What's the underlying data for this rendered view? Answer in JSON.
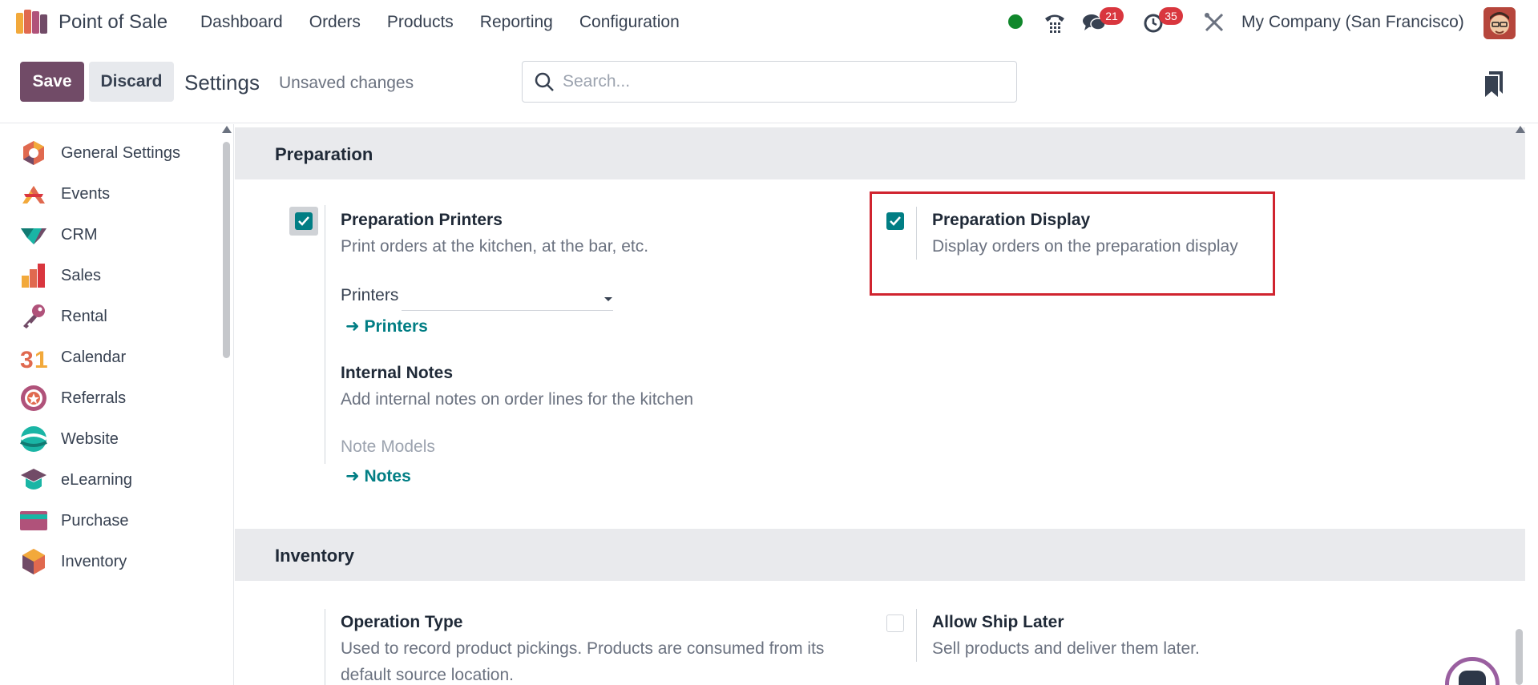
{
  "navbar": {
    "app_name": "Point of Sale",
    "menu": [
      "Dashboard",
      "Orders",
      "Products",
      "Reporting",
      "Configuration"
    ],
    "messages_count": "21",
    "activities_count": "35",
    "company": "My Company (San Francisco)",
    "status_color": "#10872b"
  },
  "control": {
    "save_label": "Save",
    "discard_label": "Discard",
    "title": "Settings",
    "status": "Unsaved changes",
    "search_placeholder": "Search..."
  },
  "sidebar": {
    "items": [
      {
        "label": "General Settings",
        "icon": "odoo-icon"
      },
      {
        "label": "Events",
        "icon": "events-icon"
      },
      {
        "label": "CRM",
        "icon": "crm-icon"
      },
      {
        "label": "Sales",
        "icon": "sales-icon"
      },
      {
        "label": "Rental",
        "icon": "rental-icon"
      },
      {
        "label": "Calendar",
        "icon": "calendar-icon"
      },
      {
        "label": "Referrals",
        "icon": "referrals-icon"
      },
      {
        "label": "Website",
        "icon": "website-icon"
      },
      {
        "label": "eLearning",
        "icon": "elearning-icon"
      },
      {
        "label": "Purchase",
        "icon": "purchase-icon"
      },
      {
        "label": "Inventory",
        "icon": "inventory-icon"
      }
    ]
  },
  "preparation": {
    "heading": "Preparation",
    "printers": {
      "title": "Preparation Printers",
      "desc": "Print orders at the kitchen, at the bar, etc.",
      "checked": true,
      "field_label": "Printers",
      "link": "Printers"
    },
    "internal_notes": {
      "title": "Internal Notes",
      "desc": "Add internal notes on order lines for the kitchen",
      "field_label": "Note Models",
      "link": "Notes"
    },
    "display": {
      "title": "Preparation Display",
      "desc": "Display orders on the preparation display",
      "checked": true
    }
  },
  "inventory": {
    "heading": "Inventory",
    "operation_type": {
      "title": "Operation Type",
      "desc_line1": "Used to record product pickings. Products are consumed from its",
      "desc_line2": "default source location."
    },
    "ship_later": {
      "title": "Allow Ship Later",
      "desc": "Sell products and deliver them later.",
      "checked": false
    }
  },
  "colors": {
    "brand": "#714b67",
    "accent": "#017e84",
    "highlight": "#d0242f"
  }
}
